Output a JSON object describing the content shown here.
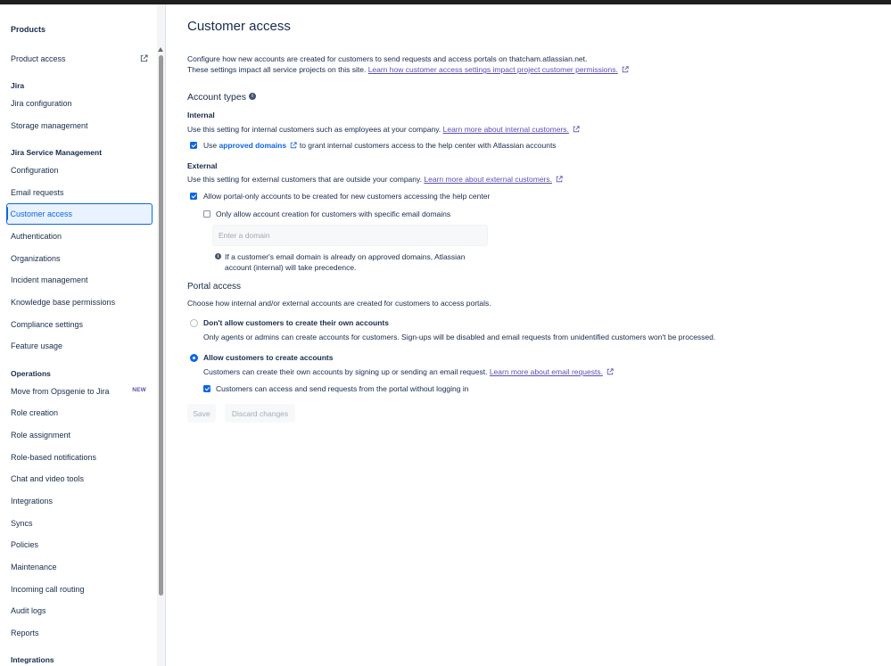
{
  "sidebar": {
    "products_heading": "Products",
    "product_access": "Product access",
    "jira_heading": "Jira",
    "jira_items": [
      "Jira configuration",
      "Storage management"
    ],
    "jsm_heading": "Jira Service Management",
    "jsm_items": [
      "Configuration",
      "Email requests",
      "Customer access",
      "Authentication",
      "Organizations",
      "Incident management",
      "Knowledge base permissions",
      "Compliance settings",
      "Feature usage"
    ],
    "operations_heading": "Operations",
    "operations_items": [
      "Move from Opsgenie to Jira",
      "Role creation",
      "Role assignment",
      "Role-based notifications",
      "Chat and video tools",
      "Integrations",
      "Syncs",
      "Policies",
      "Maintenance",
      "Incoming call routing",
      "Audit logs",
      "Reports"
    ],
    "new_badge": "NEW",
    "integrations_heading": "Integrations",
    "selected_item": "Customer access"
  },
  "page": {
    "title": "Customer access",
    "intro_line1": "Configure how new accounts are created for customers to send requests and access portals on thatcham.atlassian.net.",
    "intro_line2": "These settings impact all service projects on this site.",
    "intro_link": "Learn how customer access settings impact project customer permissions."
  },
  "account_types": {
    "heading": "Account types",
    "internal": {
      "heading": "Internal",
      "desc": "Use this setting for internal customers such as employees at your company.",
      "link": "Learn more about internal customers.",
      "checkbox_prefix": "Use",
      "checkbox_link": "approved domains",
      "checkbox_suffix": "to grant internal customers access to the help center with Atlassian accounts",
      "checked": true
    },
    "external": {
      "heading": "External",
      "desc": "Use this setting for external customers that are outside your company.",
      "link": "Learn more about external customers.",
      "allow_portal_label": "Allow portal-only accounts to be created for new customers accessing the help center",
      "allow_portal_checked": true,
      "only_domains_label": "Only allow account creation for customers with specific email domains",
      "only_domains_checked": false,
      "domain_placeholder": "Enter a domain",
      "note_line1": "If a customer's email domain is already on approved domains, Atlassian",
      "note_line2": "account (internal) will take precedence."
    }
  },
  "portal_access": {
    "heading": "Portal access",
    "desc": "Choose how internal and/or external accounts are created for customers to access portals.",
    "option1_label": "Don't allow customers to create their own accounts",
    "option1_desc": "Only agents or admins can create accounts for customers. Sign-ups will be disabled and email requests from unidentified customers won't be processed.",
    "option1_selected": false,
    "option2_label": "Allow customers to create accounts",
    "option2_desc": "Customers can create their own accounts by signing up or sending an email request.",
    "option2_link": "Learn more about email requests.",
    "option2_selected": true,
    "no_login_label": "Customers can access and send requests from the portal without logging in",
    "no_login_checked": true
  },
  "actions": {
    "save": "Save",
    "discard": "Discard changes"
  },
  "colors": {
    "accent": "#0c66e4",
    "link": "#5e4db2"
  }
}
